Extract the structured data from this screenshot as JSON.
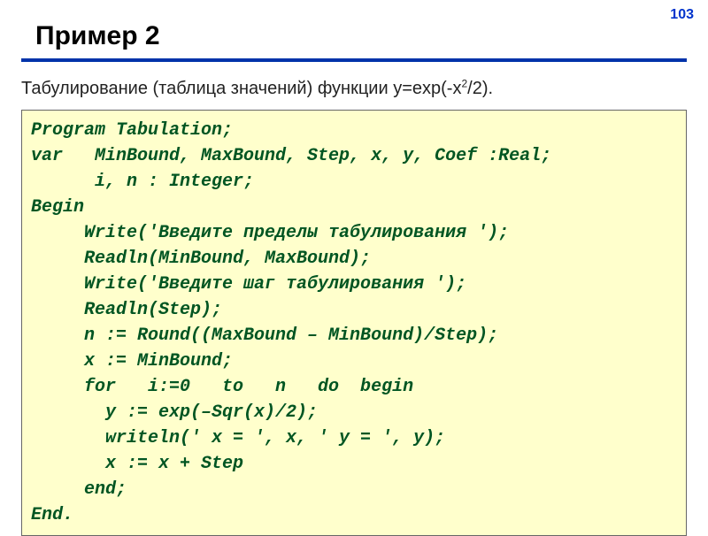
{
  "page_number": "103",
  "title": "Пример 2",
  "subtitle_pre": "Табулирование (таблица значений) функции y=exp(-x",
  "subtitle_sup": "2",
  "subtitle_post": "/2).",
  "code": "Program Tabulation;\nvar   MinBound, MaxBound, Step, x, y, Coef :Real;\n      i, n : Integer;\nBegin\n     Write('Введите пределы табулирования ');\n     Readln(MinBound, MaxBound);\n     Write('Введите шаг табулирования ');\n     Readln(Step);\n     n := Round((MaxBound – MinBound)/Step);\n     x := MinBound;\n     for   i:=0   to   n   do  begin\n       y := exp(–Sqr(x)/2);\n       writeln(' x = ', x, ' y = ', y);\n       x := x + Step\n     end;\nEnd."
}
